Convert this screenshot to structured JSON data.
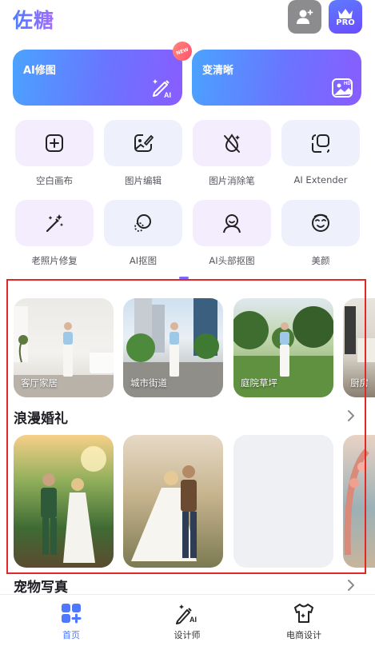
{
  "app": {
    "logo": "佐糖"
  },
  "header": {
    "pro_label": "PRO",
    "user_icon": "user-plus-icon",
    "pro_icon": "crown-icon"
  },
  "features": [
    {
      "label": "AI修图",
      "icon": "ai-brush-icon",
      "badge": "NEW"
    },
    {
      "label": "变清晰",
      "icon": "hd-image-icon"
    }
  ],
  "tools": [
    {
      "label": "空白画布",
      "icon": "plus-square-icon"
    },
    {
      "label": "图片编辑",
      "icon": "image-edit-icon"
    },
    {
      "label": "图片消除笔",
      "icon": "eraser-drop-icon"
    },
    {
      "label": "AI Extender",
      "icon": "expand-icon"
    },
    {
      "label": "老照片修复",
      "icon": "magic-wand-icon"
    },
    {
      "label": "AI抠图",
      "icon": "cutout-circle-icon"
    },
    {
      "label": "AI头部抠图",
      "icon": "head-cutout-icon"
    },
    {
      "label": "美颜",
      "icon": "beauty-face-icon"
    }
  ],
  "scenes": [
    {
      "label": "客厅家居"
    },
    {
      "label": "城市街道"
    },
    {
      "label": "庭院草坪"
    },
    {
      "label": "厨房"
    }
  ],
  "sections": [
    {
      "title": "浪漫婚礼"
    },
    {
      "title": "宠物写真"
    }
  ],
  "tabbar": [
    {
      "label": "首页",
      "icon": "home-grid-icon",
      "active": true
    },
    {
      "label": "设计师",
      "icon": "ai-pen-icon",
      "active": false
    },
    {
      "label": "电商设计",
      "icon": "tshirt-icon",
      "active": false
    }
  ],
  "colors": {
    "accent": "#4d78ff",
    "highlight": "#e32626"
  }
}
